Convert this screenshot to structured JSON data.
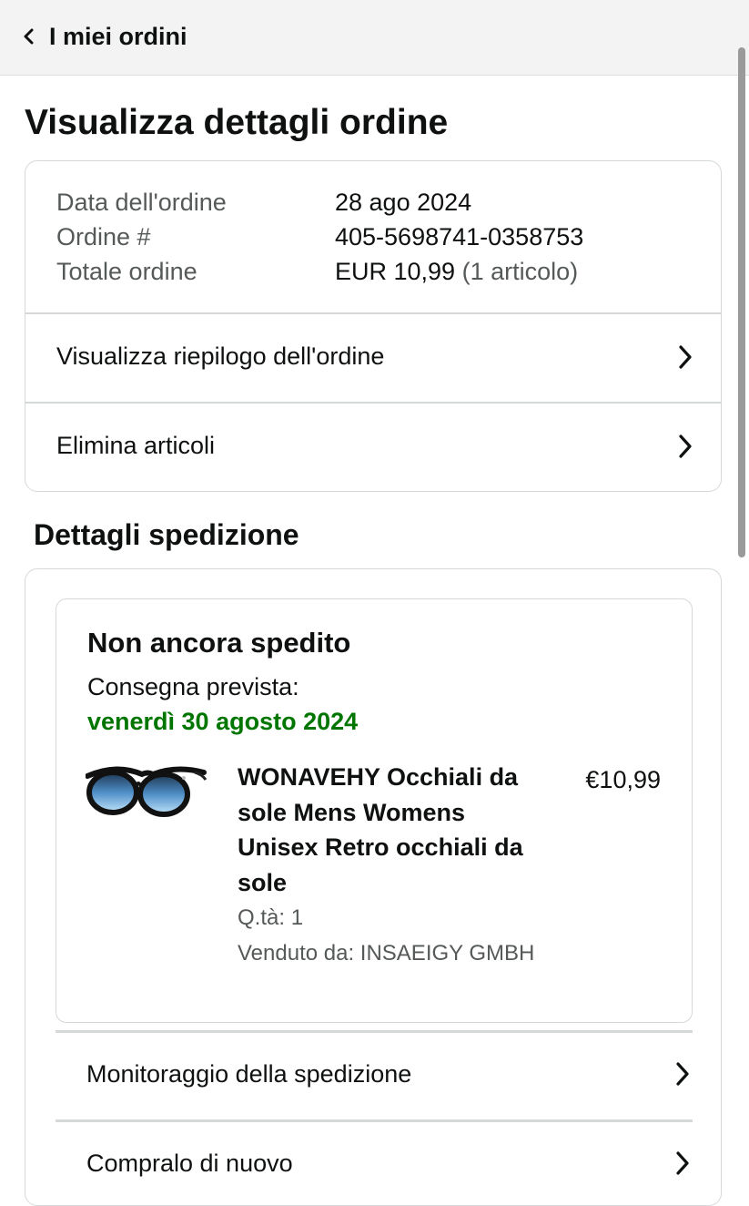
{
  "header": {
    "back_label": "I miei ordini"
  },
  "page_title": "Visualizza dettagli ordine",
  "order_info": {
    "date_label": "Data dell'ordine",
    "date_value": "28 ago 2024",
    "number_label": "Ordine #",
    "number_value": "405-5698741-0358753",
    "total_label": "Totale ordine",
    "total_value": "EUR 10,99",
    "total_items": "(1 articolo)"
  },
  "order_links": [
    {
      "label": "Visualizza riepilogo dell'ordine"
    },
    {
      "label": "Elimina articoli"
    }
  ],
  "shipment_section_title": "Dettagli spedizione",
  "shipment": {
    "status": "Non ancora spedito",
    "delivery_label": "Consegna prevista:",
    "delivery_date": "venerdì 30 agosto 2024",
    "item": {
      "title": "WONAVEHY Occhiali da sole Mens Womens Unisex Retro occhiali da sole",
      "price": "€10,99",
      "quantity": "Q.tà: 1",
      "seller": "Venduto da: INSAEIGY GMBH",
      "image_icon": "sunglasses-image"
    }
  },
  "shipment_actions": [
    {
      "label": "Monitoraggio della spedizione"
    },
    {
      "label": "Compralo di nuovo"
    }
  ],
  "colors": {
    "delivery_green": "#007600",
    "border": "#d5d9d9",
    "header_bg": "#f3f3f3",
    "muted_text": "#565959"
  }
}
